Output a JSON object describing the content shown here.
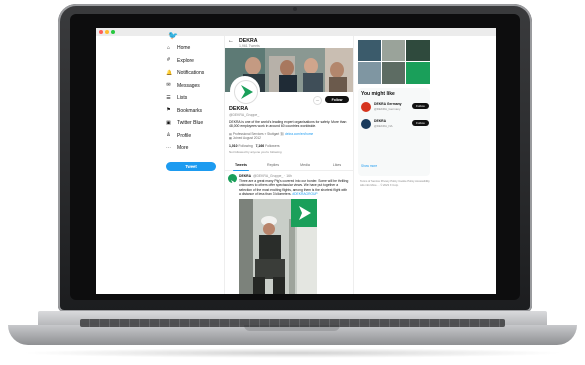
{
  "window": {
    "traffic_colors": [
      "#ff5f57",
      "#febc2e",
      "#28c840"
    ]
  },
  "sidebar": {
    "items": [
      {
        "label": "Home",
        "icon": "home-icon",
        "glyph": "⌂"
      },
      {
        "label": "Explore",
        "icon": "hashtag-icon",
        "glyph": "#"
      },
      {
        "label": "Notifications",
        "icon": "bell-icon",
        "glyph": "🔔"
      },
      {
        "label": "Messages",
        "icon": "envelope-icon",
        "glyph": "✉"
      },
      {
        "label": "Lists",
        "icon": "list-icon",
        "glyph": "☰"
      },
      {
        "label": "Bookmarks",
        "icon": "bookmark-icon",
        "glyph": "⚑"
      },
      {
        "label": "Twitter Blue",
        "icon": "twitter-blue-icon",
        "glyph": "▣"
      },
      {
        "label": "Profile",
        "icon": "person-icon",
        "glyph": "♙"
      },
      {
        "label": "More",
        "icon": "more-circle-icon",
        "glyph": "⋯"
      }
    ],
    "tweet_button": "Tweet",
    "brand_color": "#1d9bf0"
  },
  "profile": {
    "header_name": "DEKRA",
    "header_tweets": "1,961 Tweets",
    "name": "DEKRA",
    "handle": "@DEKRA_Gruppe_",
    "bio": "DEKRA is one of the world's leading expert organisations for safety. More than 48,000 employees work in around 60 countries worldwide.",
    "category": "Professional Services",
    "location": "Stuttgart",
    "website": "dekra.com/en/home",
    "joined": "Joined August 2012",
    "following_count": "1,010",
    "following_label": "Following",
    "followers_count": "7,166",
    "followers_label": "Followers",
    "followed_by": "Not followed by anyone you're following",
    "follow_button": "Follow"
  },
  "tabs": [
    {
      "label": "Tweets",
      "active": true
    },
    {
      "label": "Replies",
      "active": false
    },
    {
      "label": "Media",
      "active": false
    },
    {
      "label": "Likes",
      "active": false
    }
  ],
  "tweet": {
    "name": "DEKRA",
    "handle": "@DEKRA_Gruppe_ · 16h",
    "text": "Three are a great many Ptg's covered into our border. Some will be thrilling unknowns to others offer spectacular views. We have put together a selection of the most exciting flights, among them is the shortest flight with a distance of less than 3 kilometers.",
    "link": "#DEKRAGROUP"
  },
  "right": {
    "title": "You might like",
    "suggestions": [
      {
        "name": "DEKRA Germany",
        "handle": "@DEKRA_Germany",
        "color": "#d6341e"
      },
      {
        "name": "DEKRA",
        "handle": "@DEKRA_NA",
        "color": "#1a3a5c"
      }
    ],
    "follow_label": "Follow",
    "show_more": "Show more",
    "footer": "Terms of Service  Privacy Policy  Cookie Policy  Accessibility  Ads info  More ...  © 2023 X Corp."
  }
}
